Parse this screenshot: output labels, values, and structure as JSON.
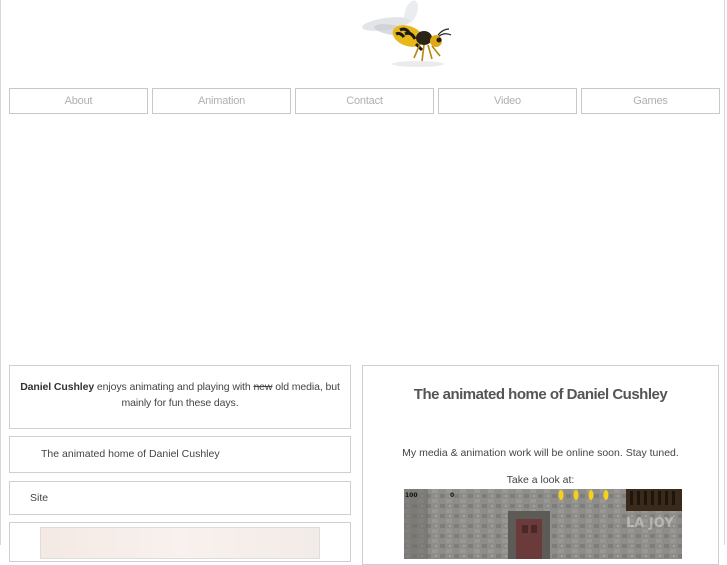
{
  "nav": {
    "items": [
      {
        "label": "About"
      },
      {
        "label": "Animation"
      },
      {
        "label": "Contact"
      },
      {
        "label": "Video"
      },
      {
        "label": "Games"
      }
    ]
  },
  "intro": {
    "name": "Daniel Cushley",
    "text_before": " enjoys animating and playing with ",
    "struck": "new",
    "text_after": " old media, but mainly for fun these days."
  },
  "sidebar": {
    "tagline": "The animated home of Daniel Cushley",
    "site_label": "Site"
  },
  "main": {
    "title": "The animated home of Daniel Cushley",
    "message": "My media & animation work will be online soon. Stay tuned.",
    "look": "Take a look at:"
  },
  "game": {
    "score": "100",
    "counter": "0",
    "watermark": "LA JOY"
  },
  "colors": {
    "nav_text": "#b0b0b0",
    "border": "#cfcfcf",
    "title": "#555555"
  }
}
